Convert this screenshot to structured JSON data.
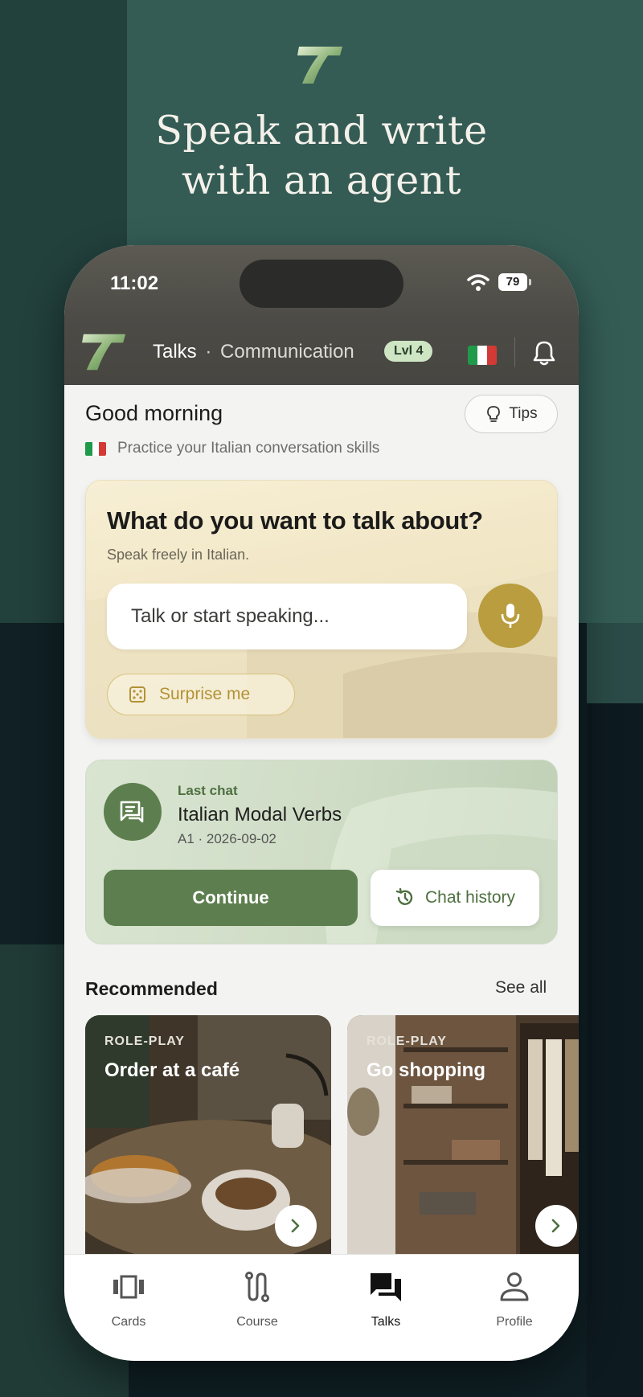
{
  "headline": {
    "line1": "Speak and write",
    "line2": "with an agent"
  },
  "status_bar": {
    "time": "11:02",
    "battery": "79"
  },
  "app_bar": {
    "title": "Talks",
    "separator": "·",
    "subtitle": "Communication",
    "level_badge": "Lvl 4",
    "language_flag_icon": "italian-flag-icon",
    "notification_icon": "bell-icon"
  },
  "greeting": {
    "text": "Good morning",
    "tips_label": "Tips",
    "tips_icon": "lightbulb-icon",
    "practice_text": "Practice your Italian conversation skills"
  },
  "talk_card": {
    "title": "What do you want to talk about?",
    "subtitle": "Speak freely in Italian.",
    "input_placeholder": "Talk or start speaking...",
    "mic_icon": "microphone-icon",
    "surprise_label": "Surprise me",
    "surprise_icon": "dice-icon"
  },
  "last_chat": {
    "label": "Last chat",
    "title": "Italian Modal Verbs",
    "meta": "A1 · 2026-09-02",
    "continue_label": "Continue",
    "history_label": "Chat history",
    "history_icon": "history-icon"
  },
  "recommended": {
    "title": "Recommended",
    "see_all": "See all",
    "items": [
      {
        "type": "ROLE-PLAY",
        "name": "Order at a café"
      },
      {
        "type": "ROLE-PLAY",
        "name": "Go shopping"
      }
    ]
  },
  "tabs": [
    {
      "label": "Cards",
      "icon": "cards-icon",
      "active": false
    },
    {
      "label": "Course",
      "icon": "course-path-icon",
      "active": false
    },
    {
      "label": "Talks",
      "icon": "chat-bubbles-icon",
      "active": true
    },
    {
      "label": "Profile",
      "icon": "person-icon",
      "active": false
    }
  ],
  "colors": {
    "accent_green": "#5d7f4f",
    "mic_gold": "#b99d3e",
    "background_teal": "#345c55",
    "level_badge": "#cfe6c5"
  }
}
